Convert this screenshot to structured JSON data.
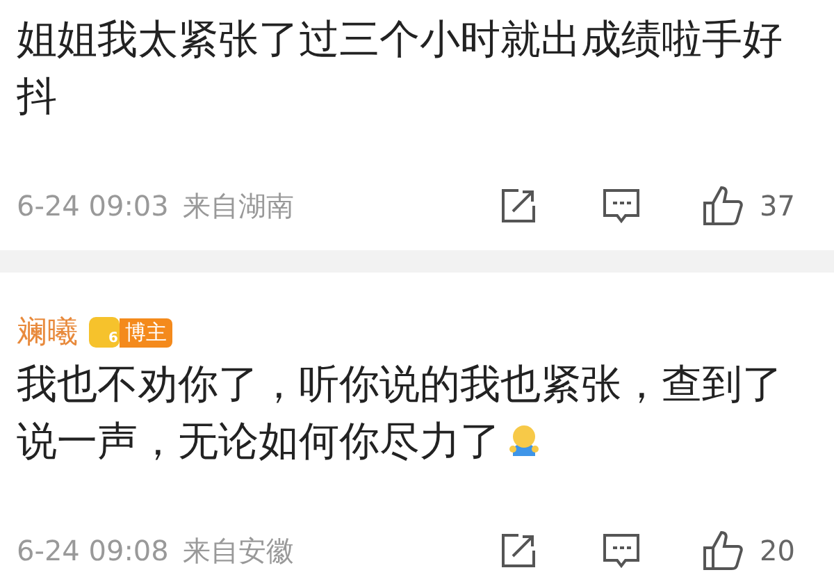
{
  "comments": [
    {
      "text": "姐姐我太紧张了过三个小时就出成绩啦手好抖",
      "time": "6-24 09:03",
      "source": "来自湖南",
      "likes": "37"
    },
    {
      "author": "斓曦",
      "badge": {
        "level": "6",
        "label": "博主"
      },
      "text": "我也不劝你了，听你说的我也紧张，查到了说一声，无论如何你尽力了",
      "emoji": true,
      "time": "6-24 09:08",
      "source": "来自安徽",
      "likes": "20"
    }
  ]
}
